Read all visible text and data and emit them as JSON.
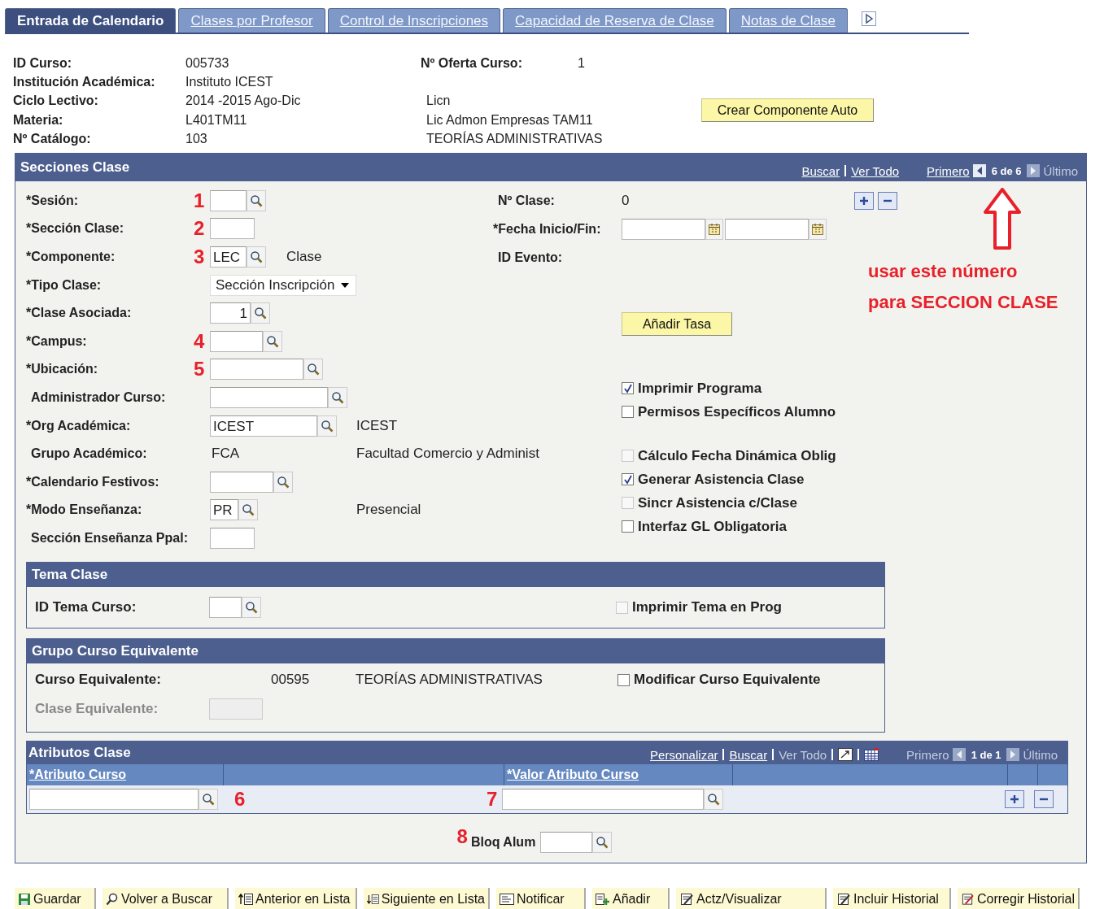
{
  "tabs": [
    {
      "label": "Entrada de Calendario",
      "selected": true
    },
    {
      "label": "Clases por Profesor",
      "selected": false
    },
    {
      "label": "Control de Inscripciones",
      "selected": false
    },
    {
      "label": "Capacidad de Reserva de Clase",
      "selected": false
    },
    {
      "label": "Notas de Clase",
      "selected": false
    }
  ],
  "header": {
    "rows": [
      {
        "label": "ID Curso:",
        "value": "005733"
      },
      {
        "label": "Institución Académica:",
        "value": "Instituto ICEST"
      },
      {
        "label": "Ciclo Lectivo:",
        "value": "2014 -2015 Ago-Dic",
        "desc": "Licn"
      },
      {
        "label": "Materia:",
        "value": "L401TM11",
        "desc": "Lic Admon Empresas TAM11"
      },
      {
        "label": "Nº Catálogo:",
        "value": "103",
        "desc": "TEORÍAS ADMINISTRATIVAS"
      }
    ],
    "offer": {
      "label": "Nº Oferta Curso:",
      "value": "1"
    },
    "button": "Crear Componente Auto"
  },
  "sections": {
    "title": "Secciones Clase",
    "links": [
      "Buscar",
      "Ver Todo"
    ],
    "pager": {
      "first": "Primero",
      "first_disabled": false,
      "count": "6 de 6",
      "last": "Último",
      "last_disabled": true
    },
    "left_fields": [
      {
        "label": "*Sesión:",
        "marker": "1",
        "kind": "lookup"
      },
      {
        "label": "*Sección Clase:",
        "marker": "2",
        "kind": "input"
      },
      {
        "label": "*Componente:",
        "marker": "3",
        "kind": "lookup",
        "value": "LEC",
        "desc": "Clase"
      },
      {
        "label": "*Tipo Clase:",
        "kind": "select",
        "value": "Sección Inscripción"
      },
      {
        "label": "*Clase Asociada:",
        "kind": "lookup",
        "value": "1"
      },
      {
        "label": "*Campus:",
        "marker": "4",
        "kind": "lookup"
      },
      {
        "label": "*Ubicación:",
        "marker": "5",
        "kind": "lookup"
      },
      {
        "label": "Administrador Curso:",
        "kind": "lookup"
      },
      {
        "label": "*Org Académica:",
        "kind": "lookup",
        "value": "ICEST",
        "desc": "ICEST"
      },
      {
        "label": "Grupo Académico:",
        "kind": "text",
        "value": "FCA",
        "desc": "Facultad Comercio y Administ"
      },
      {
        "label": "*Calendario Festivos:",
        "kind": "lookup"
      },
      {
        "label": "*Modo Enseñanza:",
        "kind": "lookup",
        "value": "PR",
        "desc": "Presencial"
      },
      {
        "label": "Sección Enseñanza Ppal:",
        "kind": "input"
      }
    ],
    "class_number": {
      "label": "Nº Clase:",
      "value": "0"
    },
    "dates": {
      "label": "*Fecha Inicio/Fin:"
    },
    "event": {
      "label": "ID Evento:"
    },
    "annotation": [
      "usar este número",
      "para SECCION CLASE"
    ],
    "fee_button": "Añadir Tasa",
    "checkbox_groups": [
      [
        {
          "label": "Imprimir Programa",
          "checked": true,
          "disabled": false
        },
        {
          "label": "Permisos Específicos Alumno",
          "checked": false,
          "disabled": false
        }
      ],
      [
        {
          "label": "Cálculo Fecha Dinámica Oblig",
          "checked": false,
          "disabled": true
        },
        {
          "label": "Generar Asistencia Clase",
          "checked": true,
          "disabled": false
        },
        {
          "label": "Sincr Asistencia c/Clase",
          "checked": false,
          "disabled": true
        },
        {
          "label": "Interfaz GL Obligatoria",
          "checked": false,
          "disabled": false
        }
      ]
    ],
    "topic": {
      "title": "Tema Clase",
      "label": "ID Tema Curso:",
      "checkbox": {
        "label": "Imprimir Tema en Prog",
        "checked": false,
        "disabled": true
      }
    },
    "equivalent": {
      "title": "Grupo Curso Equivalente",
      "label": "Curso Equivalente:",
      "code": "00595",
      "name": "TEORÍAS ADMINISTRATIVAS",
      "checkbox": {
        "label": "Modificar Curso Equivalente",
        "checked": false,
        "disabled": false
      },
      "class_label": "Clase Equivalente:"
    },
    "attributes": {
      "title": "Atributos Clase",
      "links": [
        {
          "label": "Personalizar",
          "disabled": false
        },
        {
          "label": "Buscar",
          "disabled": false
        },
        {
          "label": "Ver Todo",
          "disabled": true
        }
      ],
      "pager": {
        "first": "Primero",
        "first_disabled": true,
        "count": "1 de 1",
        "last": "Último",
        "last_disabled": true
      },
      "columns": [
        "*Atributo Curso",
        "*Valor Atributo Curso"
      ],
      "markers": [
        "6",
        "7"
      ]
    },
    "lock": {
      "marker": "8",
      "label": "Bloq Alum"
    }
  },
  "toolbar": [
    "Guardar",
    "Volver a Buscar",
    "Anterior en Lista",
    "Siguiente en Lista",
    "Notificar",
    "Añadir",
    "Actz/Visualizar",
    "Incluir Historial",
    "Corregir Historial"
  ]
}
